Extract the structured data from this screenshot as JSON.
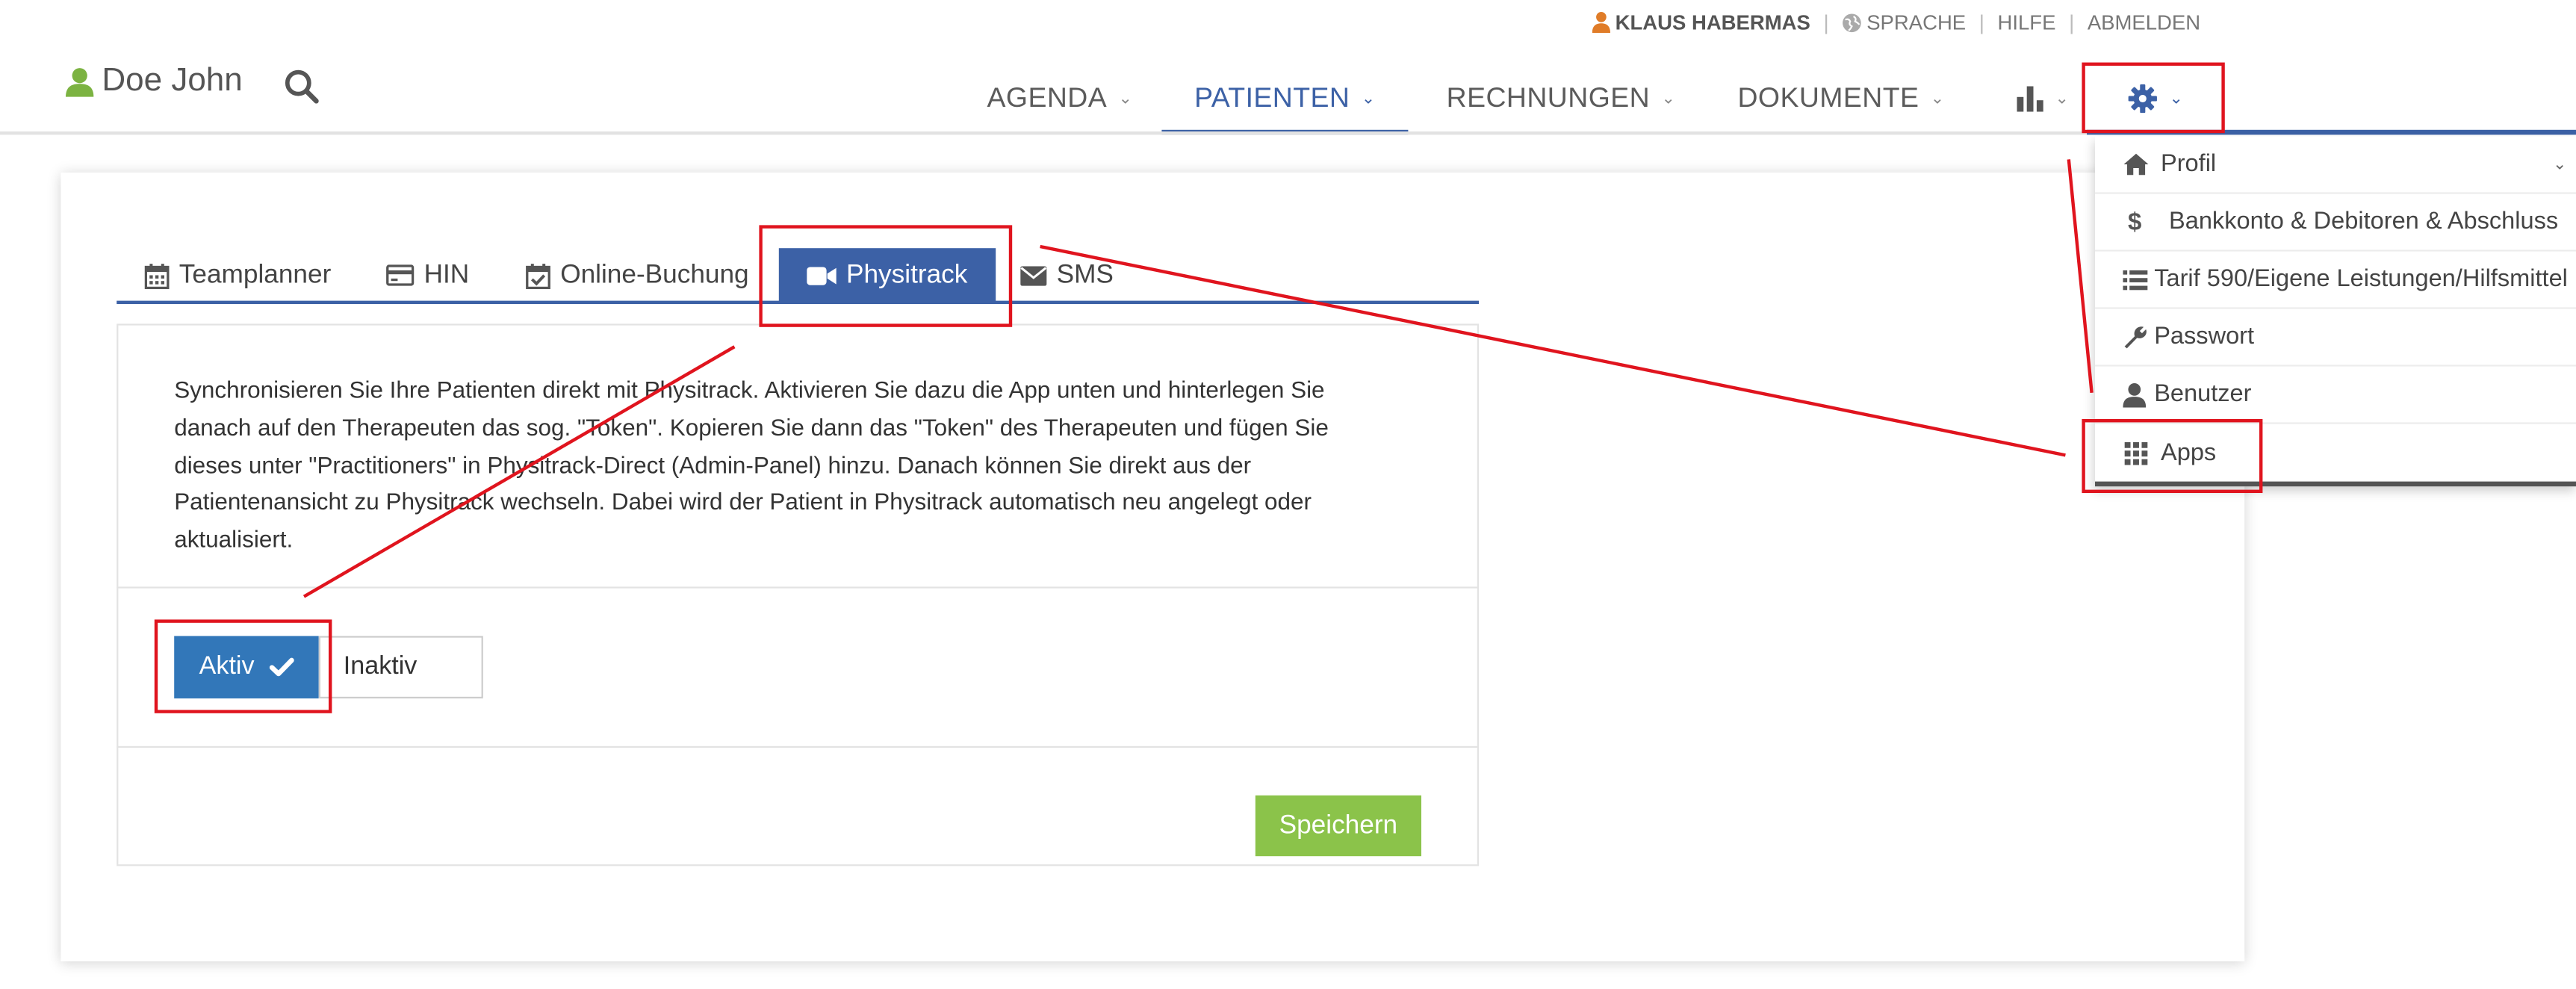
{
  "toplinks": {
    "user_name": "KLAUS HABERMAS",
    "language": "SPRACHE",
    "help": "HILFE",
    "logout": "ABMELDEN"
  },
  "header": {
    "patient_name": "Doe John",
    "nav": [
      {
        "label": "AGENDA"
      },
      {
        "label": "PATIENTEN"
      },
      {
        "label": "RECHNUNGEN"
      },
      {
        "label": "DOKUMENTE"
      }
    ],
    "active_nav": "PATIENTEN"
  },
  "tabs": [
    {
      "label": "Teamplanner",
      "icon": "calendar-icon"
    },
    {
      "label": "HIN",
      "icon": "card-icon"
    },
    {
      "label": "Online-Buchung",
      "icon": "calendar-check-icon"
    },
    {
      "label": "Physitrack",
      "icon": "video-camera-icon"
    },
    {
      "label": "SMS",
      "icon": "envelope-icon"
    }
  ],
  "active_tab": "Physitrack",
  "content": {
    "description": "Synchronisieren Sie Ihre Patienten direkt mit Physitrack. Aktivieren Sie dazu die App unten und hinterlegen Sie danach auf den Therapeuten das sog. \"Token\". Kopieren Sie dann das \"Token\" des Therapeuten und fügen Sie dieses unter \"Practitioners\" in Physitrack-Direct (Admin-Panel) hinzu. Danach können Sie direkt aus der Patientenansicht zu Physitrack wechseln. Dabei wird der Patient in Physitrack automatisch neu angelegt oder aktualisiert.",
    "aktiv_label": "Aktiv",
    "inaktiv_label": "Inaktiv",
    "selected_state": "Aktiv",
    "save_label": "Speichern"
  },
  "settings_menu": {
    "items": [
      {
        "label": "Profil",
        "icon": "home-icon"
      },
      {
        "label": "Bankkonto & Debitoren & Abschluss",
        "icon": "dollar-icon"
      },
      {
        "label": "Tarif 590/Eigene Leistungen/Hilfsmittel",
        "icon": "list-icon"
      },
      {
        "label": "Passwort",
        "icon": "wrench-icon"
      },
      {
        "label": "Benutzer",
        "icon": "user-icon"
      },
      {
        "label": "Apps",
        "icon": "grid-icon"
      }
    ]
  },
  "colors": {
    "primary": "#3c61a6",
    "button_blue": "#3277b9",
    "save_green": "#8bc34a",
    "annotation_red": "#e0141e",
    "user_orange": "#e07c28",
    "patient_green": "#7cb342"
  }
}
